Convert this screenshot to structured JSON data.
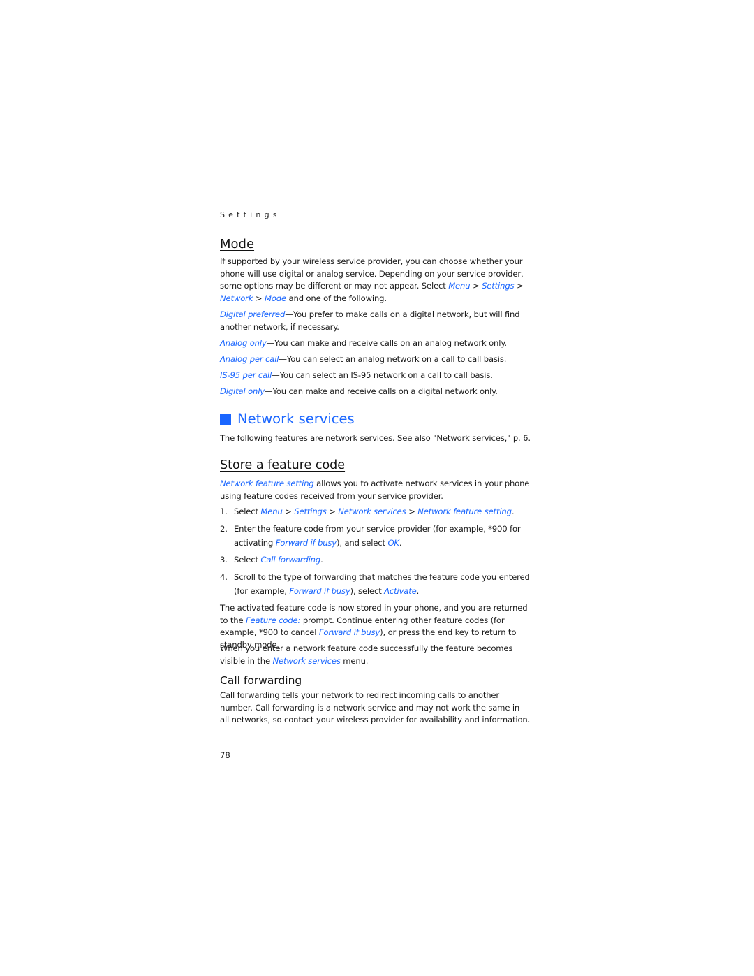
{
  "running_head": "Settings",
  "mode": {
    "heading": "Mode",
    "intro": {
      "pre": "If supported by your wireless service provider, you can choose whether your phone will use digital or analog service. Depending on your service provider, some options may be different or may not appear. Select ",
      "path": [
        "Menu",
        "Settings",
        "Network",
        "Mode"
      ],
      "sep": " > ",
      "post": " and one of the following."
    },
    "options": [
      {
        "term": "Digital preferred",
        "desc": "—You prefer to make calls on a digital network, but will find another network, if necessary."
      },
      {
        "term": "Analog only",
        "desc": "—You can make and receive calls on an analog network only."
      },
      {
        "term": "Analog per call",
        "desc": "—You can select an analog network on a call to call basis."
      },
      {
        "term": "IS-95 per call",
        "desc": "—You can select an IS-95 network on a call to call basis."
      },
      {
        "term": "Digital only",
        "desc": "—You can make and receive calls on a digital network only."
      }
    ]
  },
  "network_services": {
    "heading": "Network services",
    "intro": "The following features are network services. See also \"Network services,\" p. 6."
  },
  "store_feature_code": {
    "heading": "Store a feature code",
    "intro_link": "Network feature setting",
    "intro_rest": " allows you to activate network services in your phone using feature codes received from your service provider.",
    "steps": [
      {
        "num": "1.",
        "pre": "Select ",
        "l1": "Menu",
        "s1": " > ",
        "l2": "Settings",
        "s2": " > ",
        "l3": "Network services",
        "s3": " > ",
        "l4": "Network feature setting",
        "post": "."
      },
      {
        "num": "2.",
        "pre": "Enter the feature code from your service provider (for example, *900 for activating ",
        "l1": "Forward if busy",
        "mid": "), and select ",
        "l2": "OK",
        "post": "."
      },
      {
        "num": "3.",
        "pre": "Select ",
        "l1": "Call forwarding",
        "post": "."
      },
      {
        "num": "4.",
        "pre": "Scroll to the type of forwarding that matches the feature code you entered (for example, ",
        "l1": "Forward if busy",
        "mid": "), select ",
        "l2": "Activate",
        "post": "."
      }
    ],
    "para1": {
      "pre": "The activated feature code is now stored in your phone, and you are returned to the ",
      "l1": "Feature code:",
      "mid": " prompt. Continue entering other feature codes (for example, *900 to cancel ",
      "l2": "Forward if busy",
      "post": "), or press the end key to return to standby mode."
    },
    "para2": {
      "pre": "When you enter a network feature code successfully the feature becomes visible in the ",
      "l1": "Network services",
      "post": " menu."
    }
  },
  "call_forwarding": {
    "heading": "Call forwarding",
    "text": "Call forwarding tells your network to redirect incoming calls to another number. Call forwarding is a network service and may not work the same in all networks, so contact your wireless provider for availability and information."
  },
  "page_number": "78",
  "colors": {
    "accent": "#1a66ff",
    "text": "#1a1a1a"
  }
}
